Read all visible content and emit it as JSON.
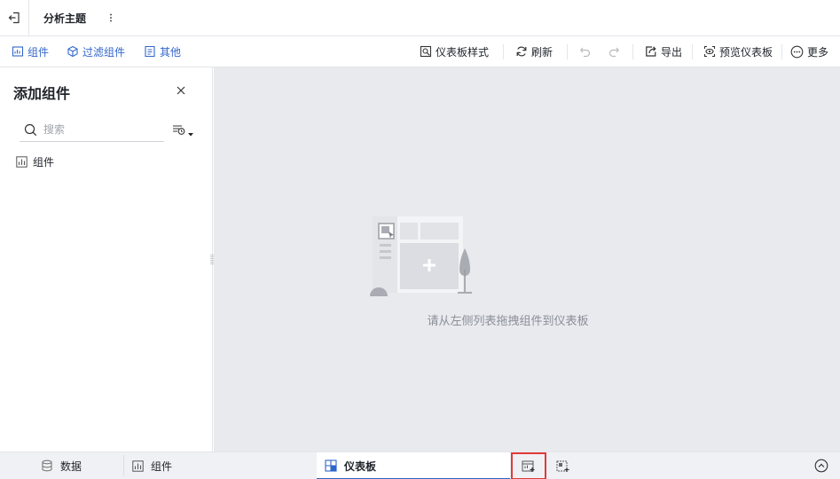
{
  "topbar": {
    "title": "分析主题"
  },
  "toolbar": {
    "left": [
      {
        "label": "组件",
        "icon": "widget-icon"
      },
      {
        "label": "过滤组件",
        "icon": "filter-widget-icon"
      },
      {
        "label": "其他",
        "icon": "other-icon"
      }
    ],
    "right": {
      "style": "仪表板样式",
      "refresh": "刷新",
      "export": "导出",
      "preview": "预览仪表板",
      "more": "更多"
    }
  },
  "panel": {
    "title": "添加组件",
    "search_placeholder": "搜索",
    "tree_item": "组件"
  },
  "canvas": {
    "empty_text": "请从左侧列表拖拽组件到仪表板"
  },
  "bottombar": {
    "data": "数据",
    "widget": "组件",
    "dashboard": "仪表板"
  },
  "colors": {
    "accent": "#3366cc",
    "highlight_border": "#e03a3a",
    "canvas_bg": "#e9eaee"
  }
}
